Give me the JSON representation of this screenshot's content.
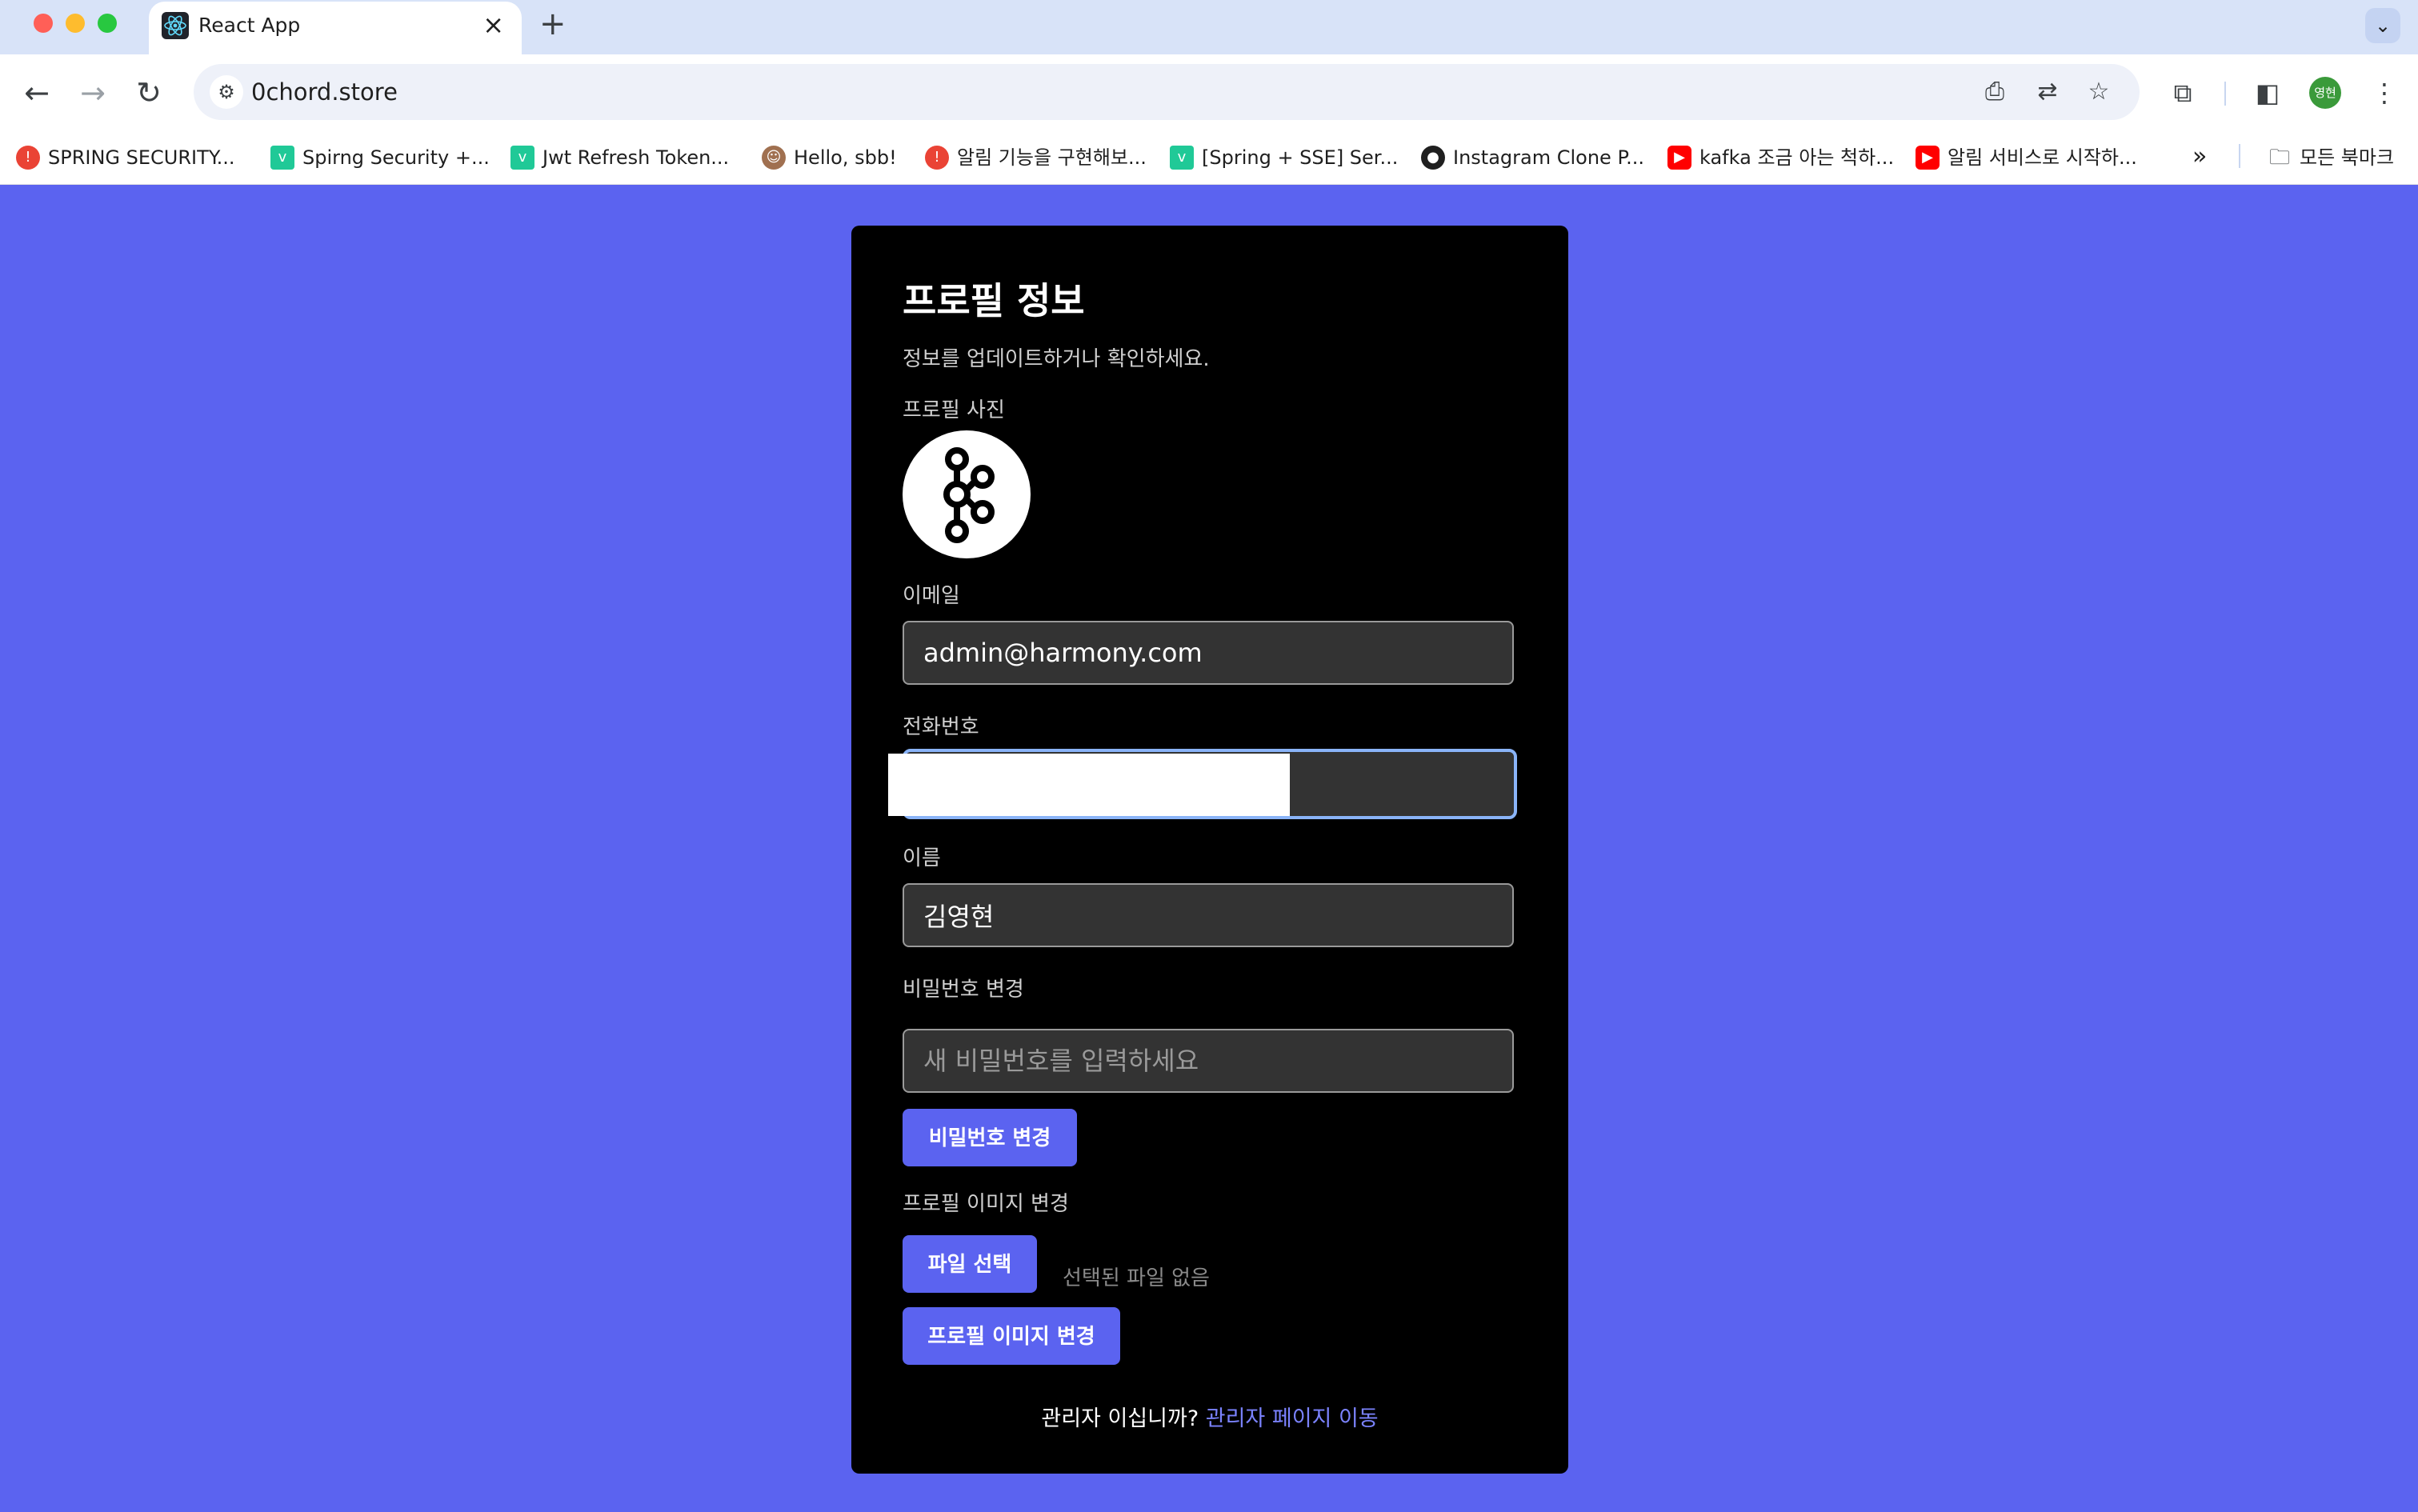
{
  "browser": {
    "tab_title": "React App",
    "url": "0chord.store",
    "profile_initials": "영현",
    "bookmarks": [
      {
        "label": "SPRING SECURITY...",
        "icon": "red-circle-icon",
        "color": "#ea4335"
      },
      {
        "label": "Spirng Security +...",
        "icon": "velog-icon",
        "color": "#20c997"
      },
      {
        "label": "Jwt Refresh Token...",
        "icon": "velog-icon",
        "color": "#20c997"
      },
      {
        "label": "Hello, sbb!",
        "icon": "avatar-icon",
        "color": "#a07050"
      },
      {
        "label": "알림 기능을 구현해보...",
        "icon": "red-circle-icon",
        "color": "#ea4335"
      },
      {
        "label": "[Spring + SSE] Ser...",
        "icon": "velog-icon",
        "color": "#20c997"
      },
      {
        "label": "Instagram Clone P...",
        "icon": "github-icon",
        "color": "#1f1f1f"
      },
      {
        "label": "kafka 조금 아는 척하...",
        "icon": "youtube-icon",
        "color": "#ff0000"
      },
      {
        "label": "알림 서비스로 시작하...",
        "icon": "youtube-icon",
        "color": "#ff0000"
      }
    ],
    "all_bookmarks_label": "모든 북마크"
  },
  "profile": {
    "title": "프로필 정보",
    "subtitle": "정보를 업데이트하거나 확인하세요.",
    "photo_label": "프로필 사진",
    "email_label": "이메일",
    "email_value": "admin@harmony.com",
    "phone_label": "전화번호",
    "name_label": "이름",
    "name_value": "김영현",
    "password_label": "비밀번호 변경",
    "password_placeholder": "새 비밀번호를 입력하세요",
    "password_button": "비밀번호 변경",
    "image_label": "프로필 이미지 변경",
    "file_button": "파일 선택",
    "file_status": "선택된 파일 없음",
    "image_button": "프로필 이미지 변경",
    "admin_question": "관리자 이십니까?",
    "admin_link": "관리자 페이지 이동"
  },
  "colors": {
    "page_bg": "#5b63f0",
    "card_bg": "#000000",
    "accent": "#5b63f0",
    "link": "#7b83ff"
  }
}
